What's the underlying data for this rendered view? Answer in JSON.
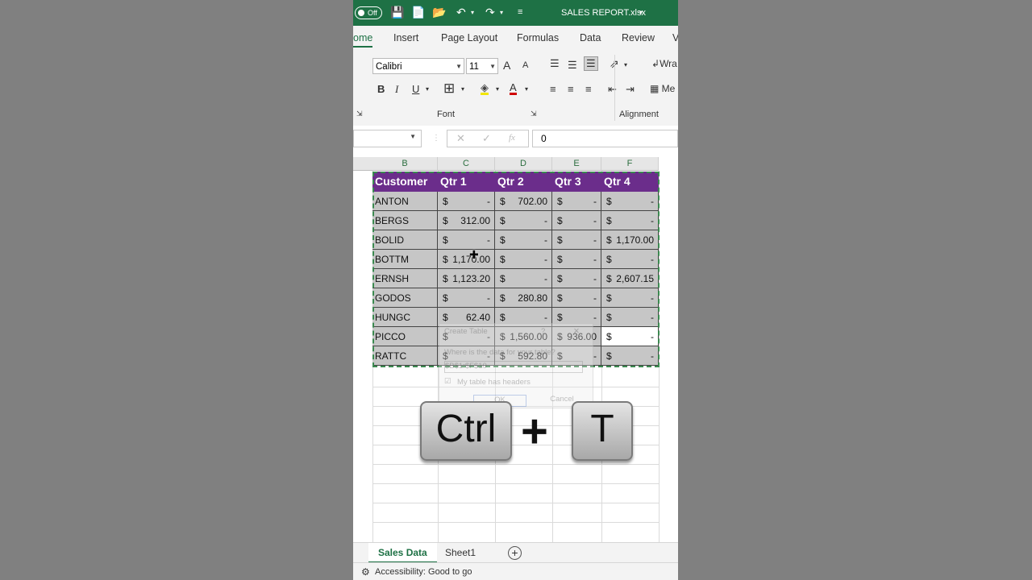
{
  "window": {
    "title": "SALES REPORT.xlsx",
    "autosave": "Off"
  },
  "tabs": [
    "ome",
    "Insert",
    "Page Layout",
    "Formulas",
    "Data",
    "Review",
    "V"
  ],
  "ribbon": {
    "font_name": "Calibri",
    "font_size": "11",
    "font_group": "Font",
    "alignment_group": "Alignment",
    "wrap_label": "Wra",
    "merge_label": "Me",
    "bold": "B",
    "italic": "I",
    "underline": "U",
    "grow": "A",
    "shrink": "A",
    "font_color": "A"
  },
  "formula_bar": {
    "value": "0",
    "fx": "fx"
  },
  "columns": [
    "B",
    "C",
    "D",
    "E",
    "F"
  ],
  "table": {
    "headers": [
      "Customer",
      "Qtr 1",
      "Qtr 2",
      "Qtr 3",
      "Qtr 4"
    ],
    "currency": "$",
    "rows": [
      {
        "name": "ANTON",
        "values": [
          "-",
          "702.00",
          "-",
          "-"
        ]
      },
      {
        "name": "BERGS",
        "values": [
          "312.00",
          "-",
          "-",
          "-"
        ]
      },
      {
        "name": "BOLID",
        "values": [
          "-",
          "-",
          "-",
          "1,170.00"
        ]
      },
      {
        "name": "BOTTM",
        "values": [
          "1,170.00",
          "-",
          "-",
          "-"
        ]
      },
      {
        "name": "ERNSH",
        "values": [
          "1,123.20",
          "-",
          "-",
          "2,607.15"
        ]
      },
      {
        "name": "GODOS",
        "values": [
          "-",
          "280.80",
          "-",
          "-"
        ]
      },
      {
        "name": "HUNGC",
        "values": [
          "62.40",
          "-",
          "-",
          "-"
        ]
      },
      {
        "name": "PICCO",
        "values": [
          "-",
          "1,560.00",
          "936.00",
          "-"
        ]
      },
      {
        "name": "RATTC",
        "values": [
          "-",
          "592.80",
          "-",
          "-"
        ]
      }
    ]
  },
  "dialog": {
    "title": "Create Table",
    "question": "Where is the data for your table?",
    "range": "$B$1:$F$10",
    "checkbox": "My table has headers",
    "ok": "OK",
    "cancel": "Cancel",
    "help": "?",
    "close": "✕"
  },
  "shortcut": {
    "key1": "Ctrl",
    "plus": "+",
    "key2": "T"
  },
  "sheets": {
    "tabs": [
      "Sales Data",
      "Sheet1"
    ],
    "add": "+"
  },
  "status": {
    "accessibility": "Accessibility: Good to go"
  },
  "colors": {
    "excel_green": "#1e7145",
    "header_purple": "#6b2d8b",
    "cell_gray": "#c6c6c6"
  }
}
